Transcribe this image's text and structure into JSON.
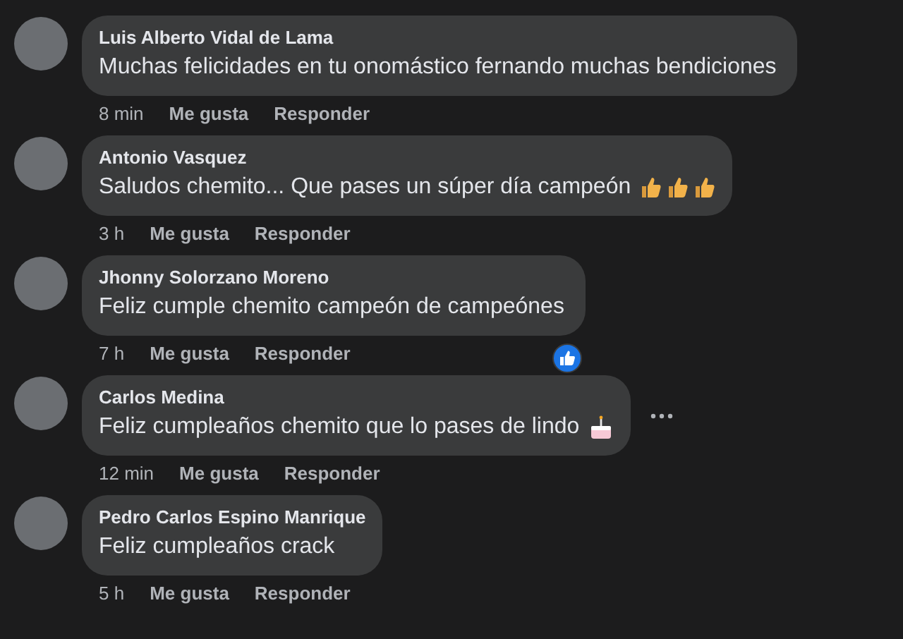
{
  "comments": [
    {
      "kind": "plain",
      "author": "Luis Alberto Vidal de Lama",
      "text": "Muchas felicidades en tu onomástico fernando muchas bendiciones",
      "time": "8 min",
      "like": "Me gusta",
      "reply": "Responder",
      "reaction_badge": false,
      "menu_shown": false
    },
    {
      "kind": "thumbs",
      "author": "Antonio Vasquez",
      "text": "Saludos chemito... Que pases un súper día campeón",
      "time": "3 h",
      "like": "Me gusta",
      "reply": "Responder",
      "reaction_badge": false,
      "menu_shown": false
    },
    {
      "kind": "plain",
      "author": "Jhonny Solorzano Moreno",
      "text": "Feliz cumple chemito campeón de campeónes",
      "time": "7 h",
      "like": "Me gusta",
      "reply": "Responder",
      "reaction_badge": true,
      "menu_shown": false
    },
    {
      "kind": "cake",
      "author": "Carlos Medina",
      "text": "Feliz cumpleaños chemito que lo pases de lindo",
      "time": "12 min",
      "like": "Me gusta",
      "reply": "Responder",
      "reaction_badge": false,
      "menu_shown": true
    },
    {
      "kind": "plain",
      "author": "Pedro Carlos Espino Manrique",
      "text": "Feliz cumpleaños crack",
      "time": "5 h",
      "like": "Me gusta",
      "reply": "Responder",
      "reaction_badge": false,
      "menu_shown": false
    }
  ]
}
